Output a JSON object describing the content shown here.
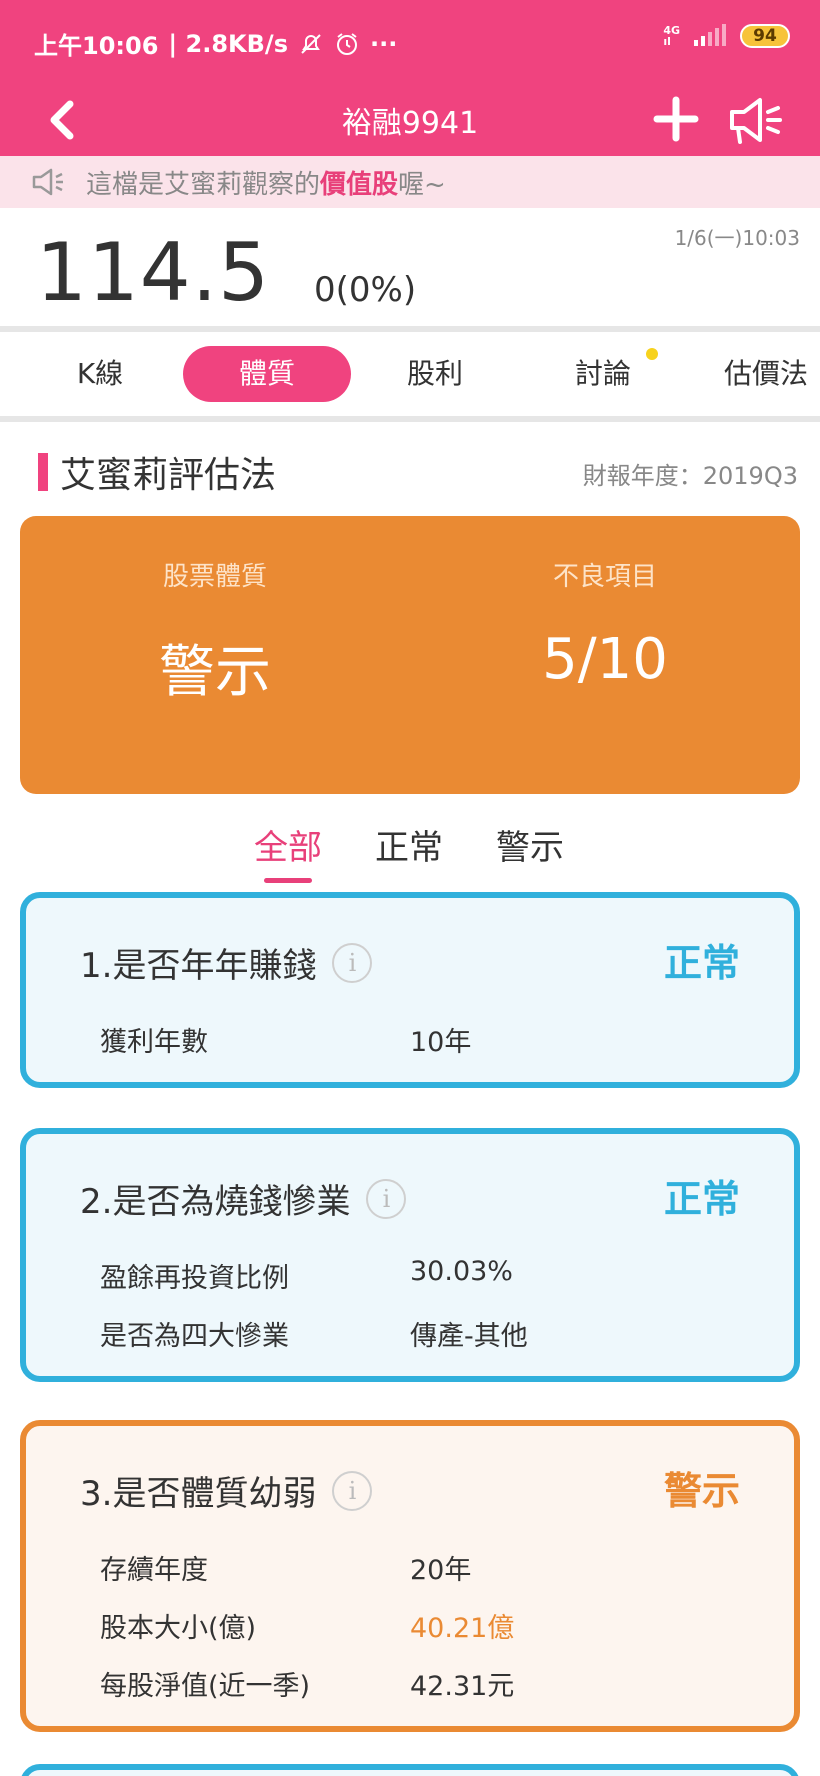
{
  "status_bar": {
    "time": "上午10:06",
    "speed": "| 2.8KB/s",
    "signal_top": "4G",
    "signal_bottom": "ıl",
    "battery": "94"
  },
  "header": {
    "title": "裕融9941"
  },
  "notice": {
    "prefix": "這檔是艾蜜莉觀察的",
    "highlight": "價值股",
    "suffix": "喔~"
  },
  "quote": {
    "price": "114.5",
    "change": "0(0%)",
    "time": "1/6(一)10:03"
  },
  "tabs": [
    {
      "label": "K線"
    },
    {
      "label": "體質"
    },
    {
      "label": "股利"
    },
    {
      "label": "討論"
    },
    {
      "label": "估價法"
    }
  ],
  "section": {
    "title": "艾蜜莉評估法",
    "report_year": "財報年度：2019Q3"
  },
  "summary": {
    "quality_label": "股票體質",
    "quality_value": "警示",
    "bad_label": "不良項目",
    "bad_value": "5/10",
    "color": "#ea8a33"
  },
  "filters": [
    {
      "label": "全部"
    },
    {
      "label": "正常"
    },
    {
      "label": "警示"
    }
  ],
  "colors": {
    "brand": "#f0437f",
    "normal": "#30b0dc",
    "warning": "#ea8a33"
  },
  "cards": [
    {
      "title": "1.是否年年賺錢",
      "status": "正常",
      "rows": [
        {
          "key": "獲利年數",
          "value": "10年"
        }
      ]
    },
    {
      "title": "2.是否為燒錢慘業",
      "status": "正常",
      "rows": [
        {
          "key": "盈餘再投資比例",
          "value": "30.03%"
        },
        {
          "key": "是否為四大慘業",
          "value": "傳產-其他"
        }
      ]
    },
    {
      "title": "3.是否體質幼弱",
      "status": "警示",
      "rows": [
        {
          "key": "存續年度",
          "value": "20年"
        },
        {
          "key": "股本大小(億)",
          "value": "40.21億"
        },
        {
          "key": "每股淨值(近一季)",
          "value": "42.31元"
        }
      ]
    }
  ]
}
